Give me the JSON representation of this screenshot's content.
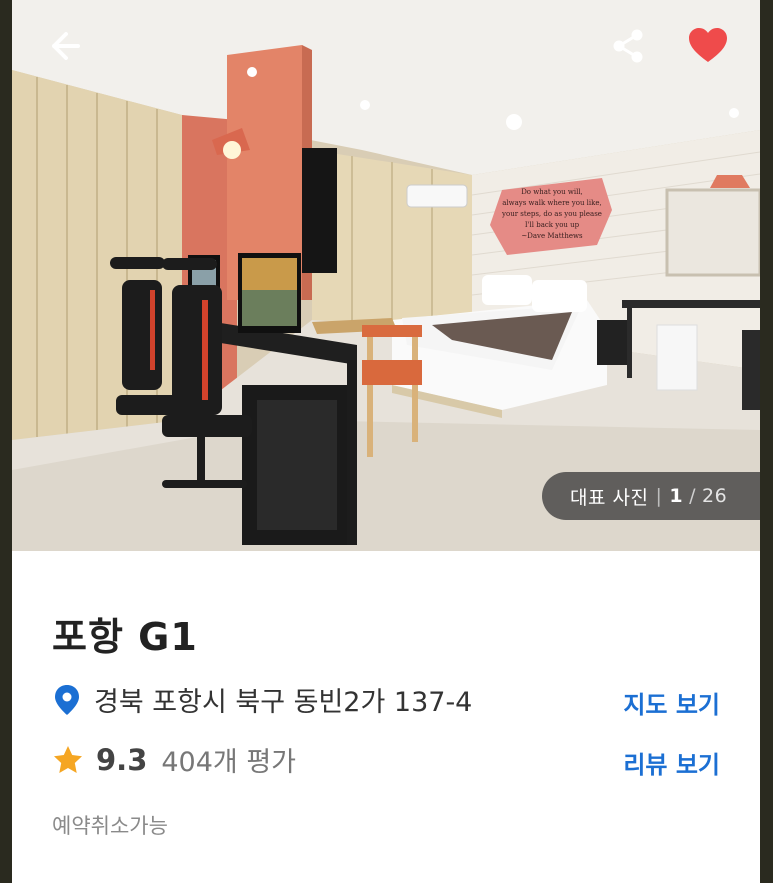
{
  "hero": {
    "photo_label": "대표 사진",
    "current_index": "1",
    "total": "26",
    "wall_quote_lines": [
      "Do what you will,",
      "always walk where you like,",
      "your steps, do as you please",
      "I'll back you up",
      "~Dave Matthews"
    ]
  },
  "icons": {
    "back": "arrow-left-icon",
    "share": "share-icon",
    "favorite": "heart-icon",
    "location": "location-pin-icon",
    "rating": "star-icon"
  },
  "hotel": {
    "name": "포항 G1",
    "address": "경북 포항시 북구 동빈2가 137-4",
    "score": "9.3",
    "review_count": "404개 평가",
    "cancel_policy": "예약취소가능"
  },
  "actions": {
    "map_label": "지도 보기",
    "review_label": "리뷰 보기"
  },
  "colors": {
    "accent": "#1b6fd3",
    "heart": "#ef4b4b",
    "star": "#f5a623",
    "pin": "#1b6fd3"
  }
}
